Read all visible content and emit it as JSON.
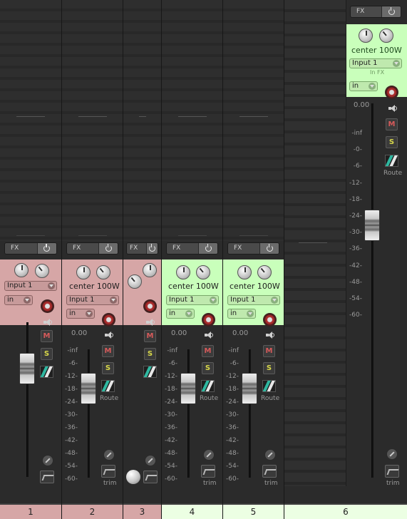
{
  "labels": {
    "fx": "FX",
    "pan": "center",
    "width": "100W",
    "input": "Input 1",
    "monitor": "in",
    "route": "Route",
    "trim": "trim",
    "volume": "0.00",
    "in_fx": "In FX",
    "M": "M",
    "S": "S"
  },
  "scale_short": [
    "-inf",
    "-6-",
    "-12-",
    "-18-",
    "-24-",
    "-30-",
    "-36-",
    "-42-",
    "-48-",
    "-54-",
    "-60-"
  ],
  "scale_master": [
    "-inf",
    "-0-",
    "-6-",
    "-12-",
    "-18-",
    "-24-",
    "-30-",
    "-36-",
    "-42-",
    "-48-",
    "-54-",
    "-60-"
  ],
  "tracks": [
    {
      "number": "1",
      "color": "#d6a6a6"
    },
    {
      "number": "2",
      "color": "#d6a6a6"
    },
    {
      "number": "3",
      "color": "#d6a6a6"
    },
    {
      "number": "4",
      "color": "#c9ffbb"
    },
    {
      "number": "5",
      "color": "#c9ffbb"
    },
    {
      "number": "6",
      "color": "#c9ffbb"
    }
  ]
}
